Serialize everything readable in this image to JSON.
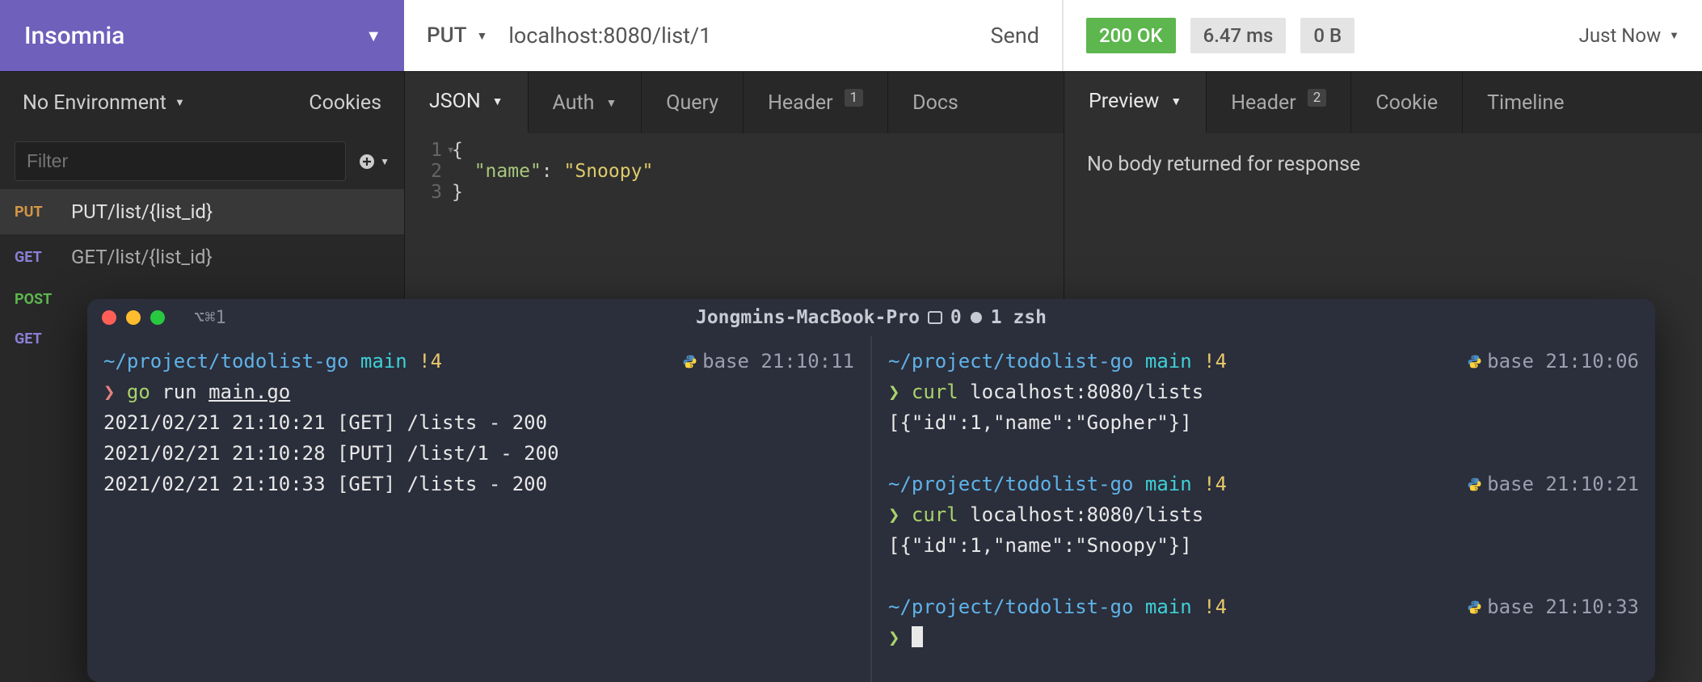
{
  "workspace": {
    "name": "Insomnia"
  },
  "request": {
    "method": "PUT",
    "url": "localhost:8080/list/1",
    "send_label": "Send"
  },
  "response": {
    "status": "200 OK",
    "time": "6.47 ms",
    "size": "0 B",
    "when": "Just Now",
    "body_msg": "No body returned for response"
  },
  "sidebar": {
    "env_label": "No Environment",
    "cookies_label": "Cookies",
    "filter_placeholder": "Filter",
    "items": [
      {
        "method": "PUT",
        "cls": "m-put",
        "name": "PUT/list/{list_id}",
        "active": true
      },
      {
        "method": "GET",
        "cls": "m-get",
        "name": "GET/list/{list_id}",
        "active": false
      },
      {
        "method": "POST",
        "cls": "m-post",
        "name": "",
        "active": false
      },
      {
        "method": "GET",
        "cls": "m-get",
        "name": "",
        "active": false
      }
    ]
  },
  "req_tabs": {
    "body": "JSON",
    "auth": "Auth",
    "query": "Query",
    "header": "Header",
    "header_badge": "1",
    "docs": "Docs"
  },
  "resp_tabs": {
    "preview": "Preview",
    "header": "Header",
    "header_badge": "2",
    "cookie": "Cookie",
    "timeline": "Timeline"
  },
  "editor": {
    "lines": [
      {
        "n": "1",
        "html": "<span class='tok-punc'>{</span>",
        "fold": true
      },
      {
        "n": "2",
        "html": "  <span class='tok-key'>\"name\"</span><span class='tok-punc'>:</span> <span class='tok-str'>\"Snoopy\"</span>"
      },
      {
        "n": "3",
        "html": "<span class='tok-punc'>}</span>"
      }
    ]
  },
  "terminal": {
    "hint": "⌥⌘1",
    "title_host": "Jongmins-MacBook-Pro",
    "title_pane0": "0",
    "title_pane1": "1 zsh",
    "left": {
      "prompt_path": "~/project/todolist-go",
      "branch": "main",
      "dirty": "!4",
      "env": "base",
      "time": "21:10:11",
      "cmd_prefix": "go",
      "cmd_rest": "run",
      "cmd_file": "main.go",
      "logs": [
        "2021/02/21 21:10:21 [GET] /lists - 200",
        "2021/02/21 21:10:28 [PUT] /list/1 - 200",
        "2021/02/21 21:10:33 [GET] /lists - 200"
      ]
    },
    "right": {
      "blocks": [
        {
          "path": "~/project/todolist-go",
          "branch": "main",
          "dirty": "!4",
          "env": "base",
          "time": "21:10:06",
          "cmd_prefix": "curl",
          "cmd_rest": "localhost:8080/lists",
          "output": "[{\"id\":1,\"name\":\"Gopher\"}]"
        },
        {
          "path": "~/project/todolist-go",
          "branch": "main",
          "dirty": "!4",
          "env": "base",
          "time": "21:10:21",
          "cmd_prefix": "curl",
          "cmd_rest": "localhost:8080/lists",
          "output": "[{\"id\":1,\"name\":\"Snoopy\"}]"
        },
        {
          "path": "~/project/todolist-go",
          "branch": "main",
          "dirty": "!4",
          "env": "base",
          "time": "21:10:33",
          "cmd_prefix": "",
          "cmd_rest": "",
          "output": ""
        }
      ]
    }
  }
}
